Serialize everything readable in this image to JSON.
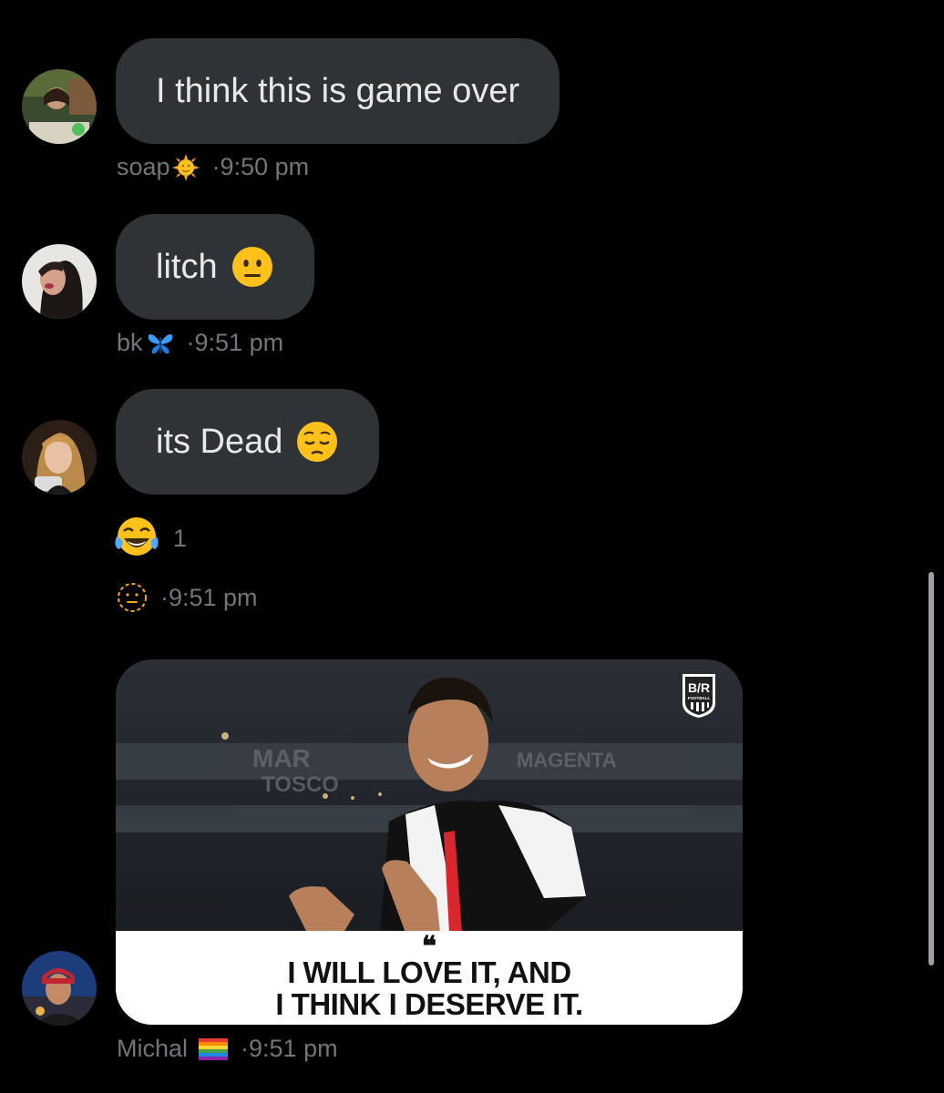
{
  "messages": [
    {
      "text": "I think this is game over",
      "sender": "soap",
      "sender_emoji": "sun-face-icon",
      "time": "·9:50 pm",
      "avatar": "avatar-woman-green-shirt"
    },
    {
      "text": "litch",
      "text_emoji": "neutral-face-icon",
      "sender": "bk",
      "sender_emoji": "butterfly-icon",
      "time": "·9:51 pm",
      "avatar": "avatar-woman-dark-hair"
    },
    {
      "text": "its Dead",
      "text_emoji": "pensive-face-icon",
      "time": "·9:51 pm",
      "avatar": "avatar-woman-blonde",
      "reaction": {
        "emoji": "tears-of-joy-icon",
        "count": "1"
      },
      "add_reaction_icon": "add-reaction-icon"
    },
    {
      "media": {
        "quote_mark": "❝",
        "caption_line1": "I WILL LOVE IT, AND",
        "caption_line2": "I THINK I DESERVE IT.",
        "logo_text": "B/R",
        "logo_sub": "FOOTBALL"
      },
      "sender": "Michal",
      "sender_emoji": "rainbow-flag-icon",
      "time": "·9:51 pm",
      "avatar": "avatar-man-red-cap"
    }
  ],
  "colors": {
    "background": "#000000",
    "bubble": "#2f3336",
    "meta_text": "#71767b",
    "bubble_text": "#e7e9ea"
  }
}
